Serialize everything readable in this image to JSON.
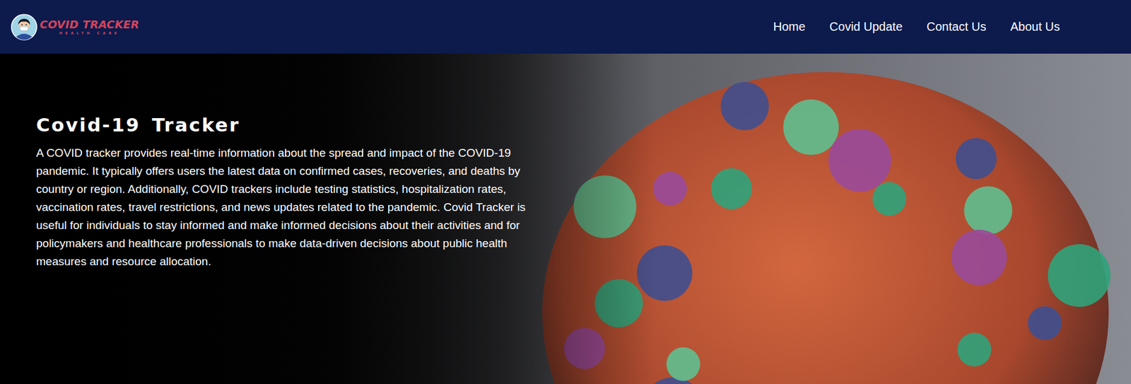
{
  "logo": {
    "title": "COVID TRACKER",
    "subtitle": "HEALTH CARE"
  },
  "nav": {
    "items": [
      {
        "label": "Home"
      },
      {
        "label": "Covid Update"
      },
      {
        "label": "Contact Us"
      },
      {
        "label": "About Us"
      }
    ]
  },
  "hero": {
    "title": "Covid-19 Tracker",
    "text": "A COVID tracker provides real-time information about the spread and impact of the COVID-19 pandemic. It typically offers users the latest data on confirmed cases, recoveries, and deaths by country or region. Additionally, COVID trackers include testing statistics, hospitalization rates, vaccination rates, travel restrictions, and news updates related to the pandemic. Covid Tracker is useful for individuals to stay informed and make informed decisions about their activities and for policymakers and healthcare professionals to make data-driven decisions about public health measures and resource allocation."
  }
}
